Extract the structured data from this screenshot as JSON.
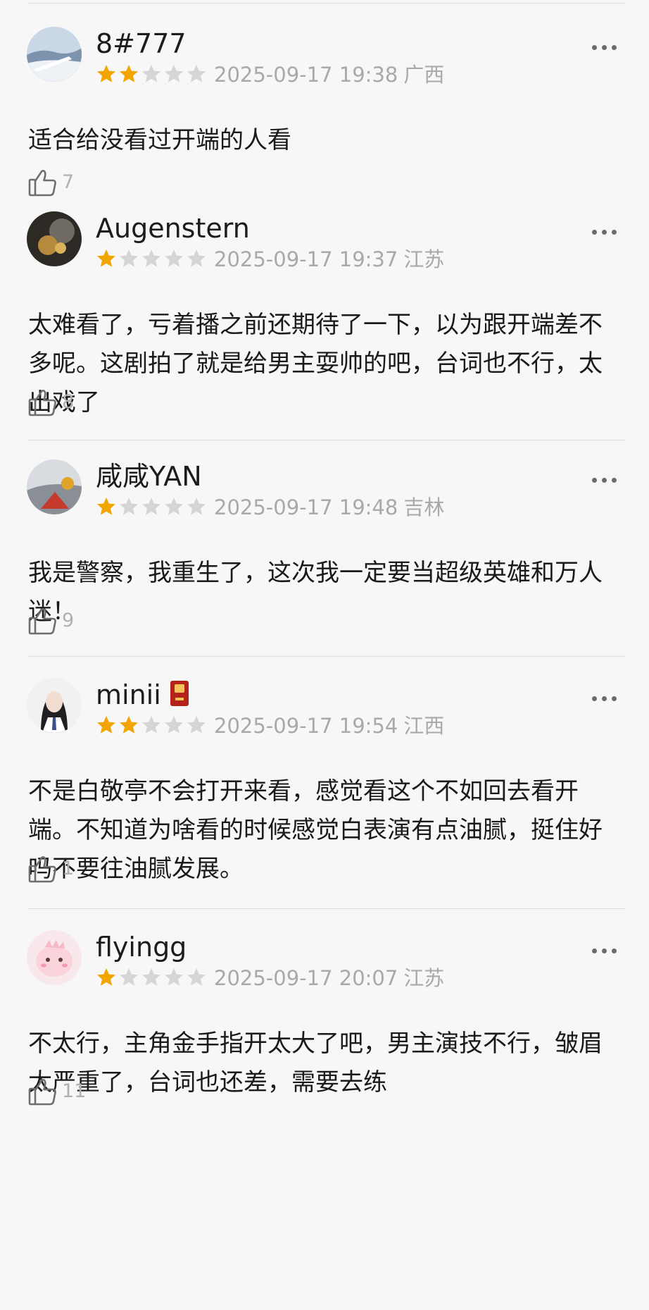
{
  "colors": {
    "star_filled": "#f2a400",
    "star_empty": "#d5d5d5",
    "meta_text": "#a9a9a9"
  },
  "icons": {
    "more": "more-dots-icon",
    "like": "thumbs-up-icon",
    "star": "star-icon"
  },
  "reviews": [
    {
      "username": "8#777",
      "rating": 2,
      "date": "2025-09-17 19:38",
      "location": "广西",
      "text": "适合给没看过开端的人看",
      "likes": "7"
    },
    {
      "username": "Augenstern",
      "rating": 1,
      "date": "2025-09-17 19:37",
      "location": "江苏",
      "text": "太难看了，亏着播之前还期待了一下，以为跟开端差不多呢。这剧拍了就是给男主耍帅的吧，台词也不行，太出戏了",
      "likes": "8"
    },
    {
      "username": "咸咸YAN",
      "rating": 1,
      "date": "2025-09-17 19:48",
      "location": "吉林",
      "text": "我是警察，我重生了，这次我一定要当超级英雄和万人迷！",
      "likes": "9"
    },
    {
      "username": "minii",
      "rating": 2,
      "date": "2025-09-17 19:54",
      "location": "江西",
      "text": "不是白敬亭不会打开来看，感觉看这个不如回去看开端。不知道为啥看的时候感觉白表演有点油腻，挺住好吗不要往油腻发展。",
      "likes": "1"
    },
    {
      "username": "flyingg",
      "rating": 1,
      "date": "2025-09-17 20:07",
      "location": "江苏",
      "text": "不太行，主角金手指开太大了吧，男主演技不行，皱眉太严重了，台词也还差，需要去练",
      "likes": "11"
    }
  ]
}
